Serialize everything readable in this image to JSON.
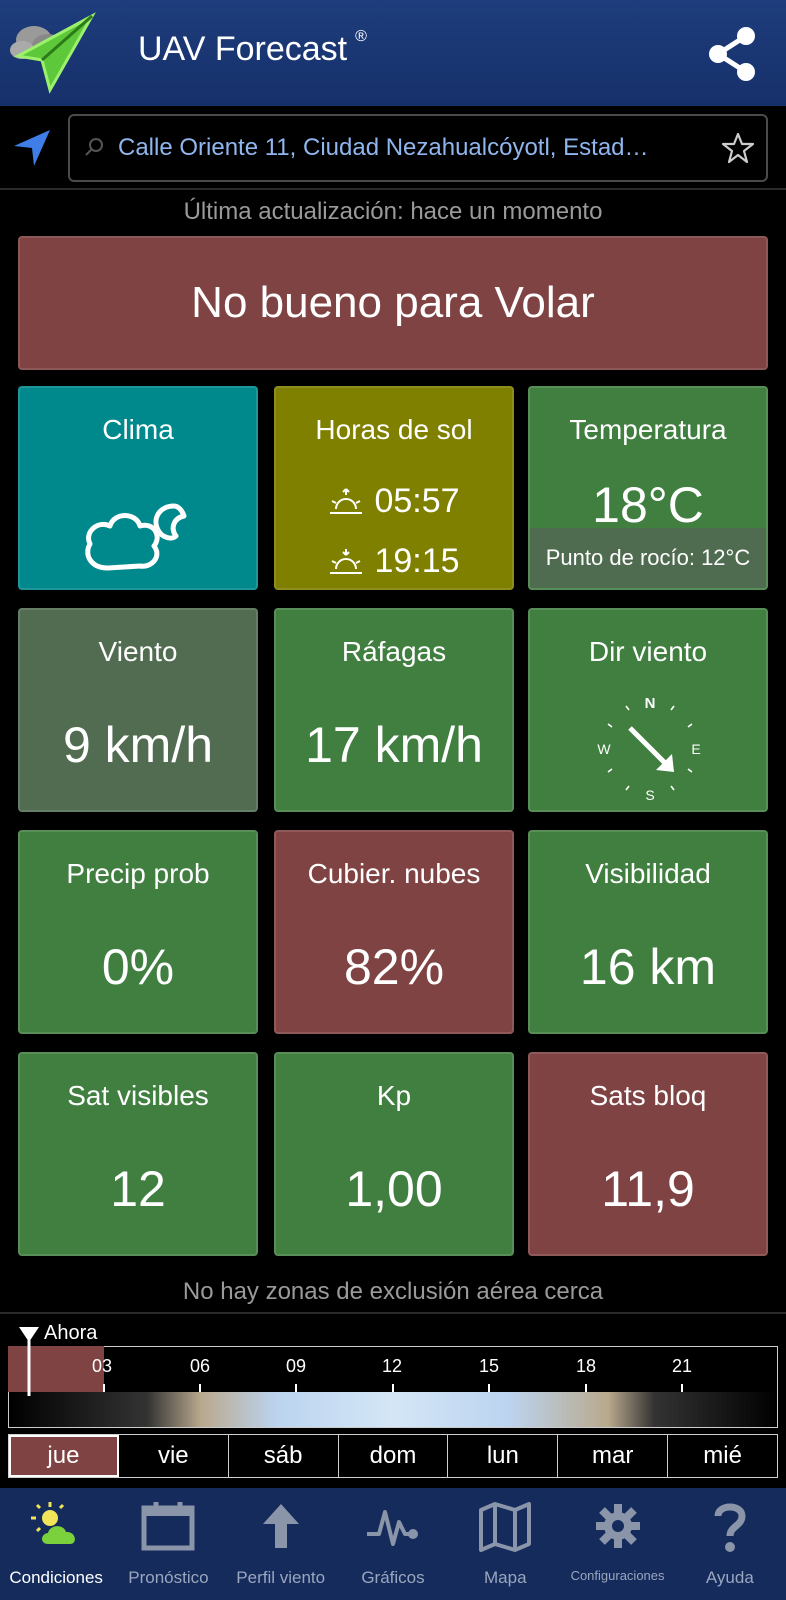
{
  "header": {
    "title": "UAV Forecast",
    "registered": "®"
  },
  "search": {
    "address": "Calle Oriente 11, Ciudad Nezahualcóyotl, Estad…"
  },
  "update_text": "Última actualización: hace un momento",
  "status_banner": "No bueno para Volar",
  "tiles": {
    "clima": {
      "label": "Clima"
    },
    "sun": {
      "label": "Horas de sol",
      "sunrise": "05:57",
      "sunset": "19:15"
    },
    "temperature": {
      "label": "Temperatura",
      "value": "18°C",
      "dew": "Punto de rocío: 12°C"
    },
    "wind": {
      "label": "Viento",
      "value": "9 km/h"
    },
    "gusts": {
      "label": "Ráfagas",
      "value": "17 km/h"
    },
    "wind_dir": {
      "label": "Dir viento",
      "n": "N",
      "e": "E",
      "s": "S",
      "w": "W"
    },
    "precip": {
      "label": "Precip prob",
      "value": "0%"
    },
    "clouds": {
      "label": "Cubier. nubes",
      "value": "82%"
    },
    "visibility": {
      "label": "Visibilidad",
      "value": "16 km"
    },
    "sats_visible": {
      "label": "Sat visibles",
      "value": "12"
    },
    "kp": {
      "label": "Kp",
      "value": "1,00"
    },
    "sats_blocked": {
      "label": "Sats bloq",
      "value": "11,9"
    }
  },
  "no_zones": "No hay zonas de exclusión aérea cerca",
  "timeline": {
    "now_label": "Ahora",
    "ticks": [
      "03",
      "06",
      "09",
      "12",
      "15",
      "18",
      "21"
    ]
  },
  "days": [
    "jue",
    "vie",
    "sáb",
    "dom",
    "lun",
    "mar",
    "mié"
  ],
  "nav": [
    {
      "label": "Condiciones",
      "icon": "sun-cloud-icon"
    },
    {
      "label": "Pronóstico",
      "icon": "calendar-icon"
    },
    {
      "label": "Perfil viento",
      "icon": "arrow-up-icon"
    },
    {
      "label": "Gráficos",
      "icon": "pulse-icon"
    },
    {
      "label": "Mapa",
      "icon": "map-icon"
    },
    {
      "label": "Configuraciones",
      "icon": "gear-icon"
    },
    {
      "label": "Ayuda",
      "icon": "question-icon"
    }
  ],
  "colors": {
    "good": "#417f41",
    "bad": "#804343",
    "header": "#1e3d7c",
    "nav": "#142b5c"
  }
}
